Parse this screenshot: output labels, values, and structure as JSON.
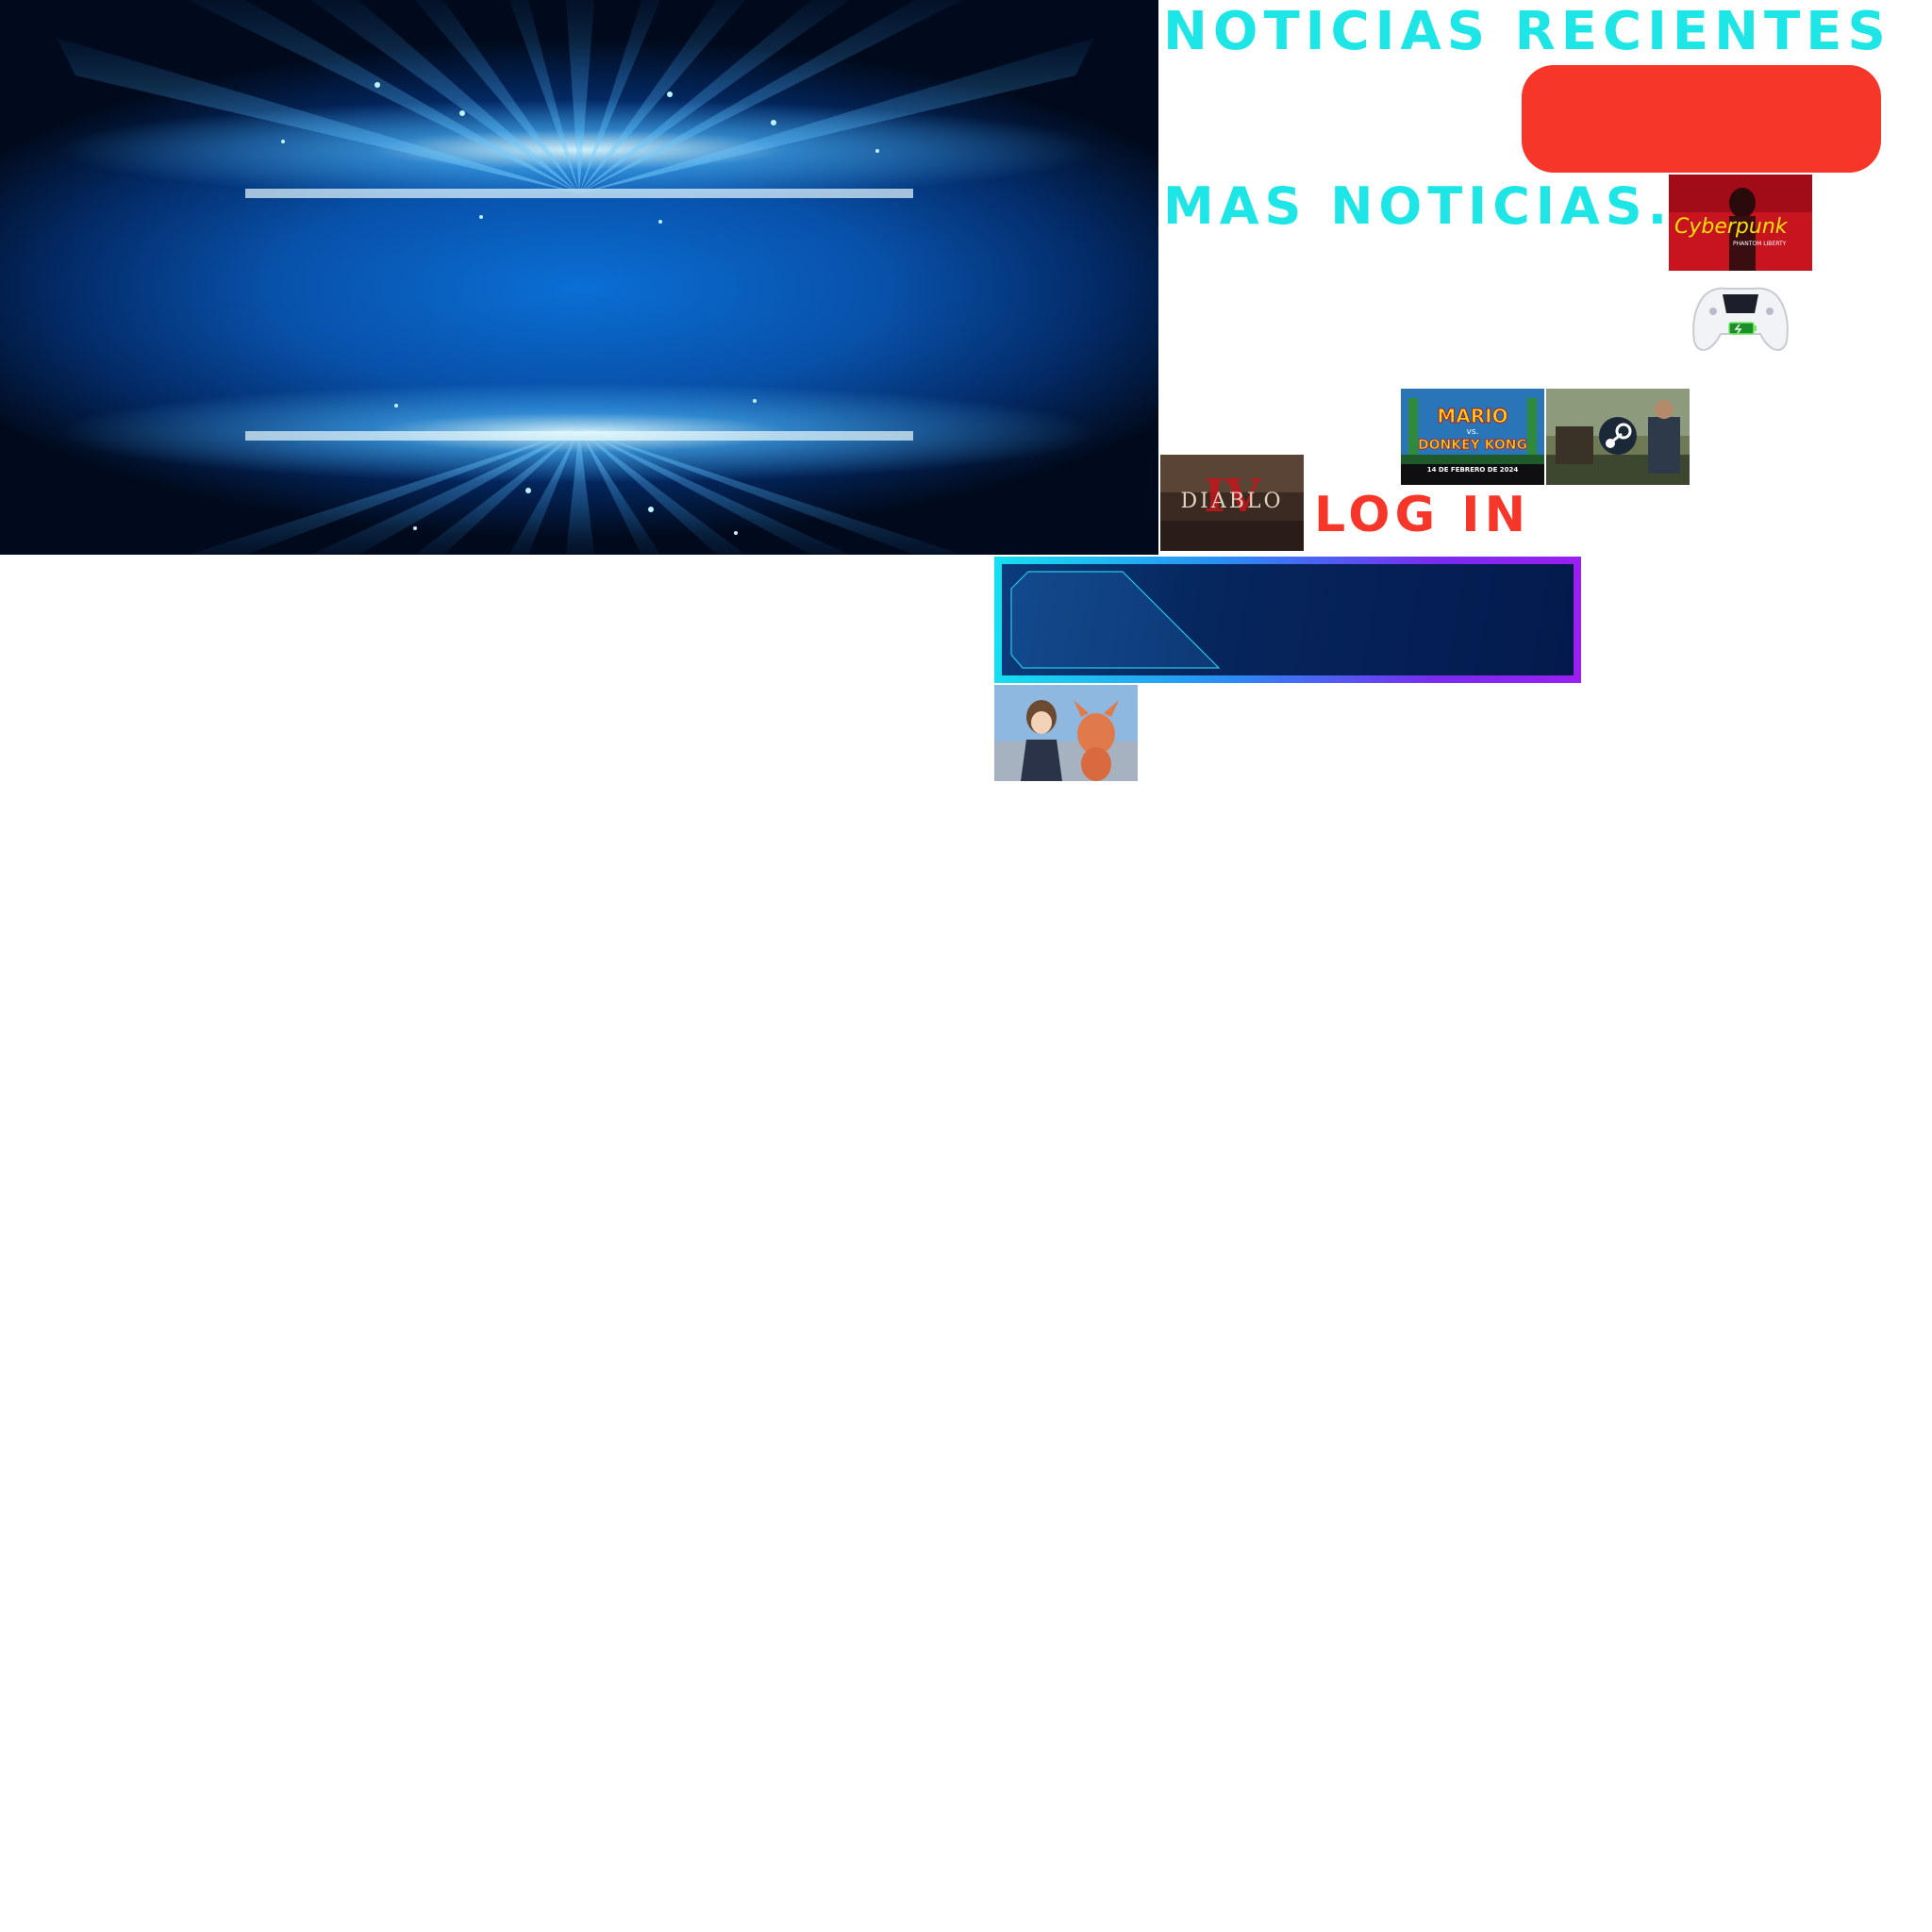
{
  "page": {
    "title_recent": "NOTICIAS RECIENTES",
    "title_more": "MAS NOTICIAS...",
    "login_label": "LOG IN"
  },
  "thumbnails": {
    "cyberpunk": {
      "text1": "Cyberpunk",
      "text2": "PHANTOM LIBERTY"
    },
    "mario": {
      "text1": "MARIO",
      "text2": "vs.",
      "text3": "DONKEY KONG",
      "text4": "14 DE FEBRERO DE 2024"
    },
    "diablo": {
      "text1": "DIABLO",
      "text2": "IV"
    }
  },
  "colors": {
    "accent_cyan": "#1ee6e6",
    "accent_red": "#f7362a",
    "panel_border_start": "#16e0f0",
    "panel_border_end": "#9b1ff0"
  },
  "icons": {
    "controller": "gamepad-icon",
    "battery": "battery-icon",
    "steam": "steam-icon"
  }
}
